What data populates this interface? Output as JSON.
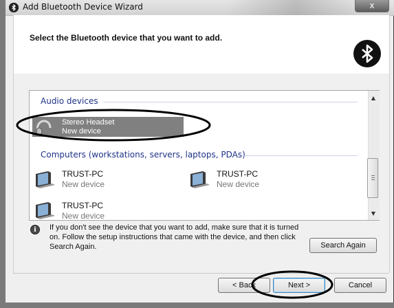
{
  "window": {
    "title": "Add Bluetooth Device Wizard",
    "close_glyph": "x"
  },
  "header": {
    "heading": "Select the Bluetooth device that you want to add."
  },
  "device_list": {
    "groups": [
      {
        "label": "Audio devices",
        "devices": [
          {
            "name": "Stereo Headset",
            "status": "New device",
            "selected": true
          }
        ]
      },
      {
        "label": "Computers (workstations, servers, laptops, PDAs)",
        "devices": [
          {
            "name": "TRUST-PC",
            "status": "New device"
          },
          {
            "name": "TRUST-PC",
            "status": "New device"
          },
          {
            "name": "TRUST-PC",
            "status": "New device"
          }
        ]
      }
    ]
  },
  "info": {
    "text": "If you don't see the device that you want to add, make sure that it is turned on. Follow the setup instructions that came with the device, and then click Search Again."
  },
  "buttons": {
    "search_again": "Search Again",
    "back": "< Back",
    "next": "Next >",
    "cancel": "Cancel"
  },
  "icons": {
    "window": "bluetooth-icon",
    "header": "bluetooth-icon",
    "headset": "headset-icon",
    "computer": "computer-icon",
    "info": "info-icon"
  }
}
